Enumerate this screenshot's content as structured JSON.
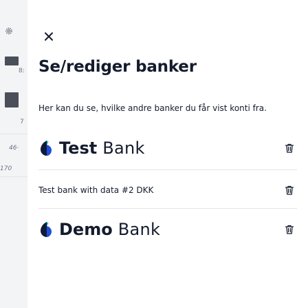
{
  "background": {
    "labels": [
      "8:",
      "7",
      "46·",
      "170"
    ]
  },
  "panel": {
    "title": "Se/rediger banker",
    "description": "Her kan du se, hvilke andre banker du får vist konti fra.",
    "banks": [
      {
        "bold": "Test",
        "light": "Bank",
        "logo": true
      },
      {
        "name": "Test bank with data #2 DKK",
        "logo": false
      },
      {
        "bold": "Demo",
        "light": "Bank",
        "logo": true
      }
    ]
  },
  "colors": {
    "text": "#141b2d",
    "logo_dark": "#101a3a",
    "logo_accent": "#21c6a7",
    "logo_blue": "#1f4fd8",
    "divider": "#e3e5e8"
  },
  "icons": {
    "close": "close-icon",
    "delete": "trash-icon",
    "settings": "gear-icon"
  }
}
